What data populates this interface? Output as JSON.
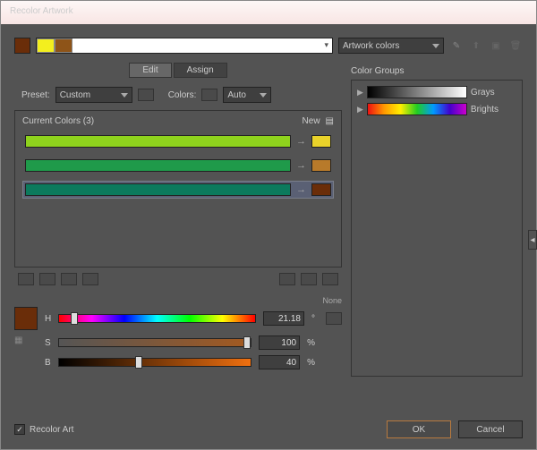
{
  "window": {
    "title": "Recolor Artwork"
  },
  "top": {
    "active_swatch": "#6a2d09",
    "harmony_colors": [
      "#f3ef1e",
      "#8e5418"
    ],
    "menu_label": "Artwork colors"
  },
  "tabs": {
    "edit": "Edit",
    "assign": "Assign"
  },
  "preset": {
    "label": "Preset:",
    "value": "Custom",
    "colors_label": "Colors:",
    "colors_value": "Auto"
  },
  "list": {
    "header_left": "Current Colors (3)",
    "header_right": "New",
    "rows": [
      {
        "current": "#8fd31d",
        "new": "#e9d22a",
        "selected": false
      },
      {
        "current": "#1f9a4a",
        "new": "#b87a2a",
        "selected": false
      },
      {
        "current": "#0c7a5d",
        "new": "#6a2d09",
        "selected": true
      }
    ]
  },
  "sliders": {
    "swatch": "#6a2d09",
    "h": {
      "label": "H",
      "value": "21.18",
      "unit": "°",
      "pos": 6
    },
    "s": {
      "label": "S",
      "value": "100",
      "unit": "%",
      "pos": 100
    },
    "b": {
      "label": "B",
      "value": "40",
      "unit": "%",
      "pos": 40
    },
    "none_label": "None"
  },
  "groups": {
    "header": "Color Groups",
    "items": [
      {
        "name": "Grays",
        "grad": "linear-gradient(90deg,#000,#555,#aaa,#fff)"
      },
      {
        "name": "Brights",
        "grad": "linear-gradient(90deg,#e11,#f90,#fe0,#2c2,#09f,#40c,#c0c)"
      }
    ]
  },
  "footer": {
    "recolor_label": "Recolor Art",
    "ok": "OK",
    "cancel": "Cancel"
  }
}
